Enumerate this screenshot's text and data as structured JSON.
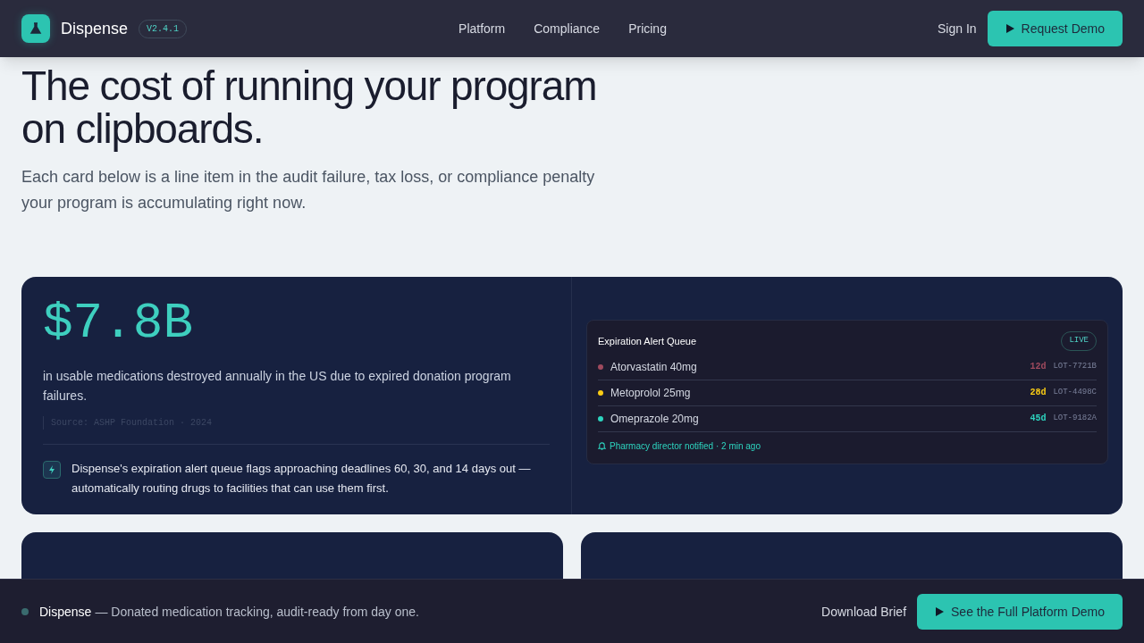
{
  "nav": {
    "brand": "Dispense",
    "version": "V2.4.1",
    "links": [
      "Platform",
      "Compliance",
      "Pricing"
    ],
    "sign_in": "Sign In",
    "cta": "Request Demo"
  },
  "hero": {
    "title": "The cost of running your program on clipboards.",
    "subtitle": "Each card below is a line item in the audit failure, tax loss, or compliance penalty your program is accumulating right now."
  },
  "feature_card": {
    "stat": "$7.8B",
    "description": "in usable medications destroyed annually in the US due to expired donation program failures.",
    "source": "Source: ASHP Foundation · 2024",
    "note": "Dispense's expiration alert queue flags approaching deadlines 60, 30, and 14 days out — automatically routing drugs to facilities that can use them first.",
    "queue": {
      "title": "Expiration Alert Queue",
      "badge": "LIVE",
      "items": [
        {
          "name": "Atorvastatin 40mg",
          "days": "12d",
          "lot": "LOT-7721B",
          "color": "#9f4a5e"
        },
        {
          "name": "Metoprolol 25mg",
          "days": "28d",
          "lot": "LOT-4498C",
          "color": "#facc15"
        },
        {
          "name": "Omeprazole 20mg",
          "days": "45d",
          "lot": "LOT-9182A",
          "color": "#2dd4bf"
        }
      ],
      "footer": "Pharmacy director notified · 2 min ago"
    }
  },
  "cards": [
    {
      "kind": "stat_card"
    },
    {
      "kind": "stat_card"
    }
  ],
  "bottom_bar": {
    "brand": "Dispense",
    "tagline": "— Donated medication tracking, audit-ready from day one.",
    "link": "Download Brief",
    "cta": "See the Full Platform Demo"
  }
}
